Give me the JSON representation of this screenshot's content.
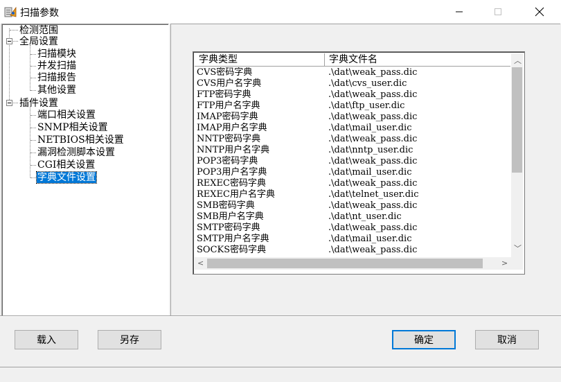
{
  "window": {
    "title": "扫描参数",
    "minimize_icon": "minimize-icon",
    "maximize_icon": "maximize-icon",
    "close_icon": "close-icon"
  },
  "tree": {
    "items": [
      {
        "label": "检测范围",
        "level": 0
      },
      {
        "label": "全局设置",
        "level": 0,
        "expanded": true
      },
      {
        "label": "扫描模块",
        "level": 1
      },
      {
        "label": "并发扫描",
        "level": 1
      },
      {
        "label": "扫描报告",
        "level": 1
      },
      {
        "label": "其他设置",
        "level": 1
      },
      {
        "label": "插件设置",
        "level": 0,
        "expanded": true
      },
      {
        "label": "端口相关设置",
        "level": 1
      },
      {
        "label": "SNMP相关设置",
        "level": 1
      },
      {
        "label": "NETBIOS相关设置",
        "level": 1
      },
      {
        "label": "漏洞检测脚本设置",
        "level": 1
      },
      {
        "label": "CGI相关设置",
        "level": 1
      },
      {
        "label": "字典文件设置",
        "level": 1,
        "selected": true
      }
    ]
  },
  "dictionary_list": {
    "columns": [
      "字典类型",
      "字典文件名"
    ],
    "rows": [
      [
        "CVS密码字典",
        ".\\dat\\weak_pass.dic"
      ],
      [
        "CVS用户名字典",
        ".\\dat\\cvs_user.dic"
      ],
      [
        "FTP密码字典",
        ".\\dat\\weak_pass.dic"
      ],
      [
        "FTP用户名字典",
        ".\\dat\\ftp_user.dic"
      ],
      [
        "IMAP密码字典",
        ".\\dat\\weak_pass.dic"
      ],
      [
        "IMAP用户名字典",
        ".\\dat\\mail_user.dic"
      ],
      [
        "NNTP密码字典",
        ".\\dat\\weak_pass.dic"
      ],
      [
        "NNTP用户名字典",
        ".\\dat\\nntp_user.dic"
      ],
      [
        "POP3密码字典",
        ".\\dat\\weak_pass.dic"
      ],
      [
        "POP3用户名字典",
        ".\\dat\\mail_user.dic"
      ],
      [
        "REXEC密码字典",
        ".\\dat\\weak_pass.dic"
      ],
      [
        "REXEC用户名字典",
        ".\\dat\\telnet_user.dic"
      ],
      [
        "SMB密码字典",
        ".\\dat\\weak_pass.dic"
      ],
      [
        "SMB用户名字典",
        ".\\dat\\nt_user.dic"
      ],
      [
        "SMTP密码字典",
        ".\\dat\\weak_pass.dic"
      ],
      [
        "SMTP用户名字典",
        ".\\dat\\mail_user.dic"
      ],
      [
        "SOCKS密码字典",
        ".\\dat\\weak_pass.dic"
      ]
    ]
  },
  "buttons": {
    "load": "载入",
    "save_as": "另存",
    "ok": "确定",
    "cancel": "取消"
  },
  "colors": {
    "selection": "#0078d7"
  }
}
